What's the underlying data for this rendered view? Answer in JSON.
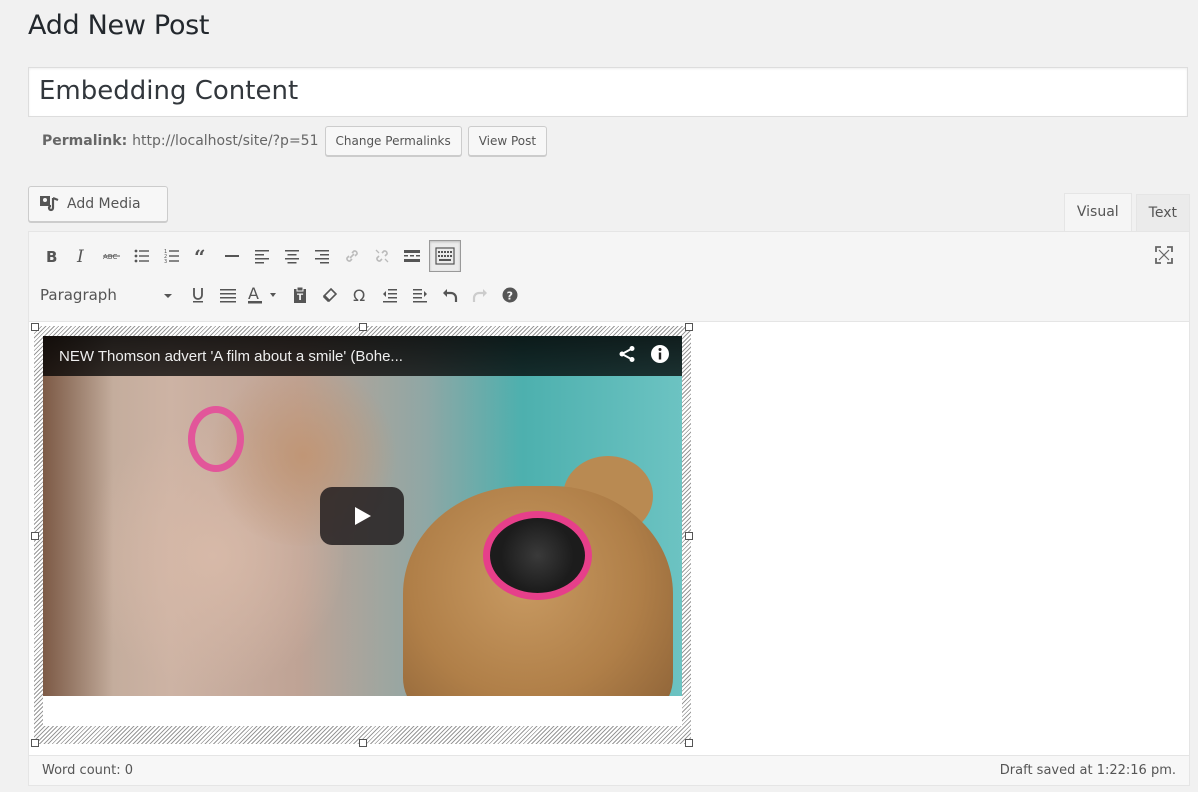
{
  "page": {
    "title": "Add New Post"
  },
  "post": {
    "title_value": "Embedding Content",
    "permalink_label": "Permalink:",
    "permalink_url": "http://localhost/site/?p=51",
    "change_permalinks_label": "Change Permalinks",
    "view_post_label": "View Post"
  },
  "media": {
    "add_media_label": "Add Media"
  },
  "tabs": [
    {
      "label": "Visual",
      "active": true
    },
    {
      "label": "Text",
      "active": false
    }
  ],
  "toolbar": {
    "row1_icons": [
      "bold-icon",
      "italic-icon",
      "strikethrough-icon",
      "bullet-list-icon",
      "numbered-list-icon",
      "blockquote-icon",
      "horizontal-rule-icon",
      "align-left-icon",
      "align-center-icon",
      "align-right-icon",
      "insert-link-icon",
      "remove-link-icon",
      "read-more-icon",
      "toolbar-toggle-icon",
      "fullscreen-icon"
    ],
    "row2_icons": [
      "underline-icon",
      "justify-icon",
      "text-color-icon",
      "paste-text-icon",
      "clear-formatting-icon",
      "special-character-icon",
      "outdent-icon",
      "indent-icon",
      "undo-icon",
      "redo-icon",
      "help-icon"
    ],
    "format_value": "Paragraph"
  },
  "embed": {
    "video_title": "NEW Thomson advert 'A film about a smile' (Bohe...",
    "icons": [
      "share-icon",
      "info-icon",
      "play-icon"
    ]
  },
  "status": {
    "word_count": "Word count: 0",
    "draft_saved": "Draft saved at 1:22:16 pm."
  },
  "colors": {
    "background": "#f1f1f1",
    "link_icon_disabled": "#bbbbbb",
    "play_button": "#231f20",
    "sunglasses_pink": "#e63f8a"
  }
}
